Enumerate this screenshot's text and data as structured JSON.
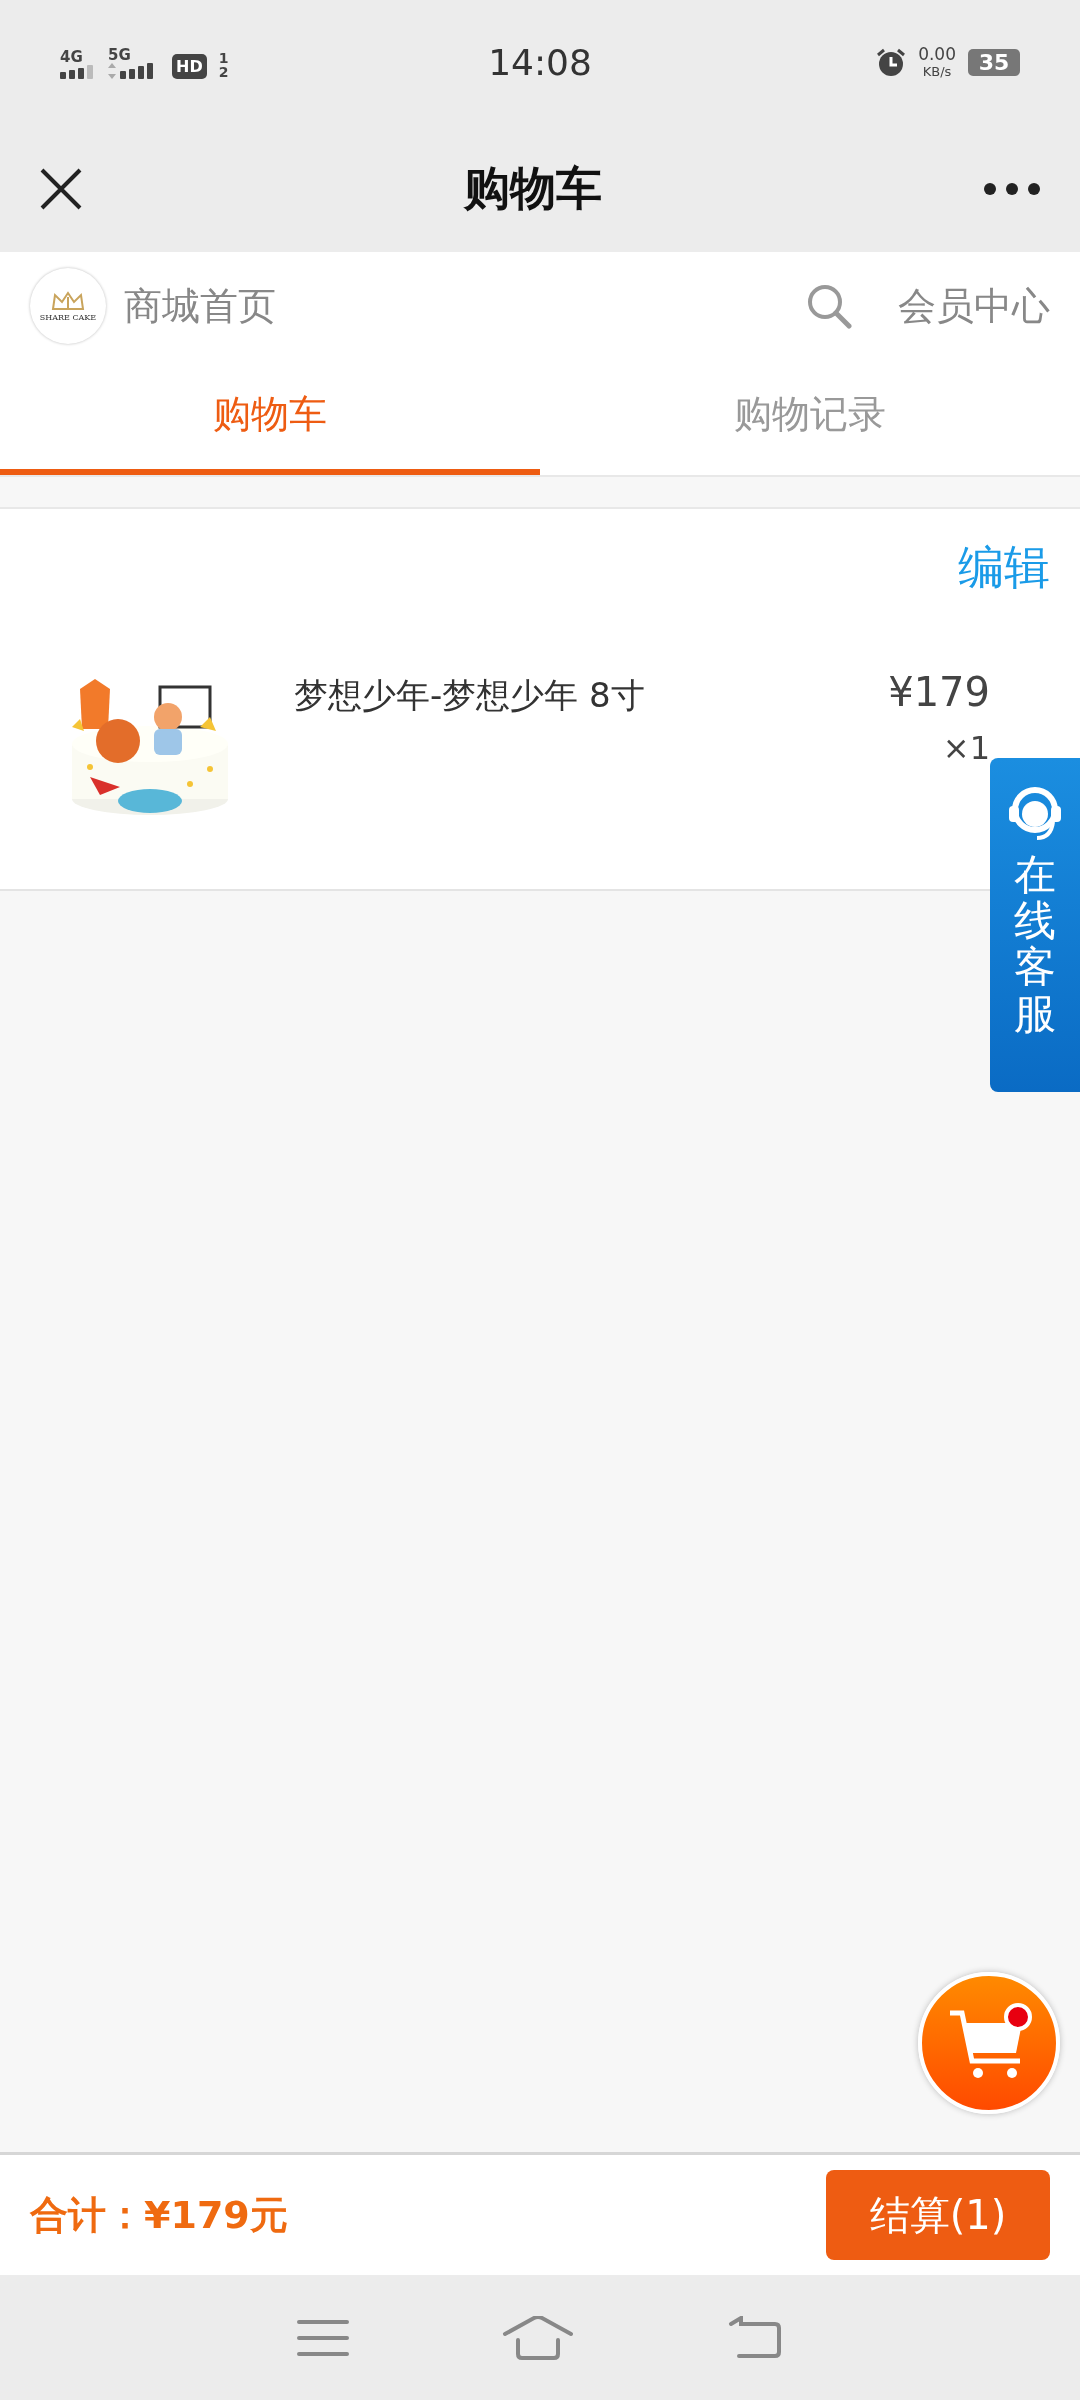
{
  "status_bar": {
    "network_1": "4G",
    "network_2": "5G",
    "hd": "HD",
    "sim_1": "1",
    "sim_2": "2",
    "time": "14:08",
    "speed": "0.00",
    "speed_unit": "KB/s",
    "battery": "35"
  },
  "nav": {
    "title": "购物车"
  },
  "store_header": {
    "logo_text": "SHARE CAKE",
    "home_link": "商城首页",
    "member_link": "会员中心"
  },
  "tabs": [
    {
      "label": "购物车",
      "selected": true
    },
    {
      "label": "购物记录",
      "selected": false
    }
  ],
  "cart": {
    "edit": "编辑",
    "items": [
      {
        "kind": "picture",
        "name": "梦想少年-梦想少年 8寸",
        "price": "¥179",
        "quantity": "×1"
      }
    ]
  },
  "service": {
    "label": "在线客服"
  },
  "footer": {
    "total": "合计：¥179元",
    "checkout": "结算(1)"
  }
}
